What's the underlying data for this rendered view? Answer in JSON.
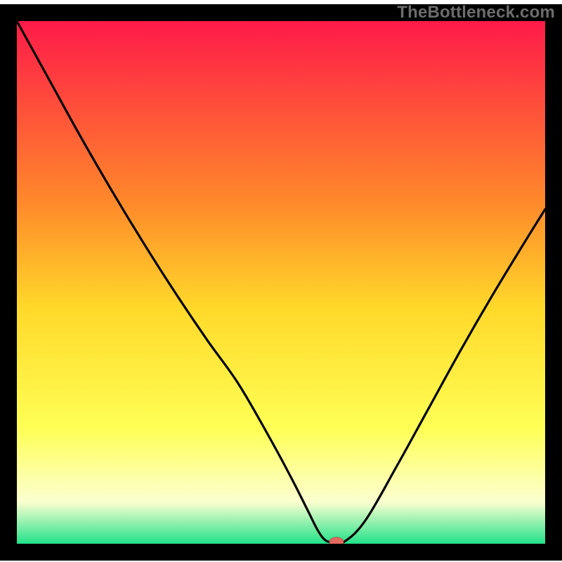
{
  "watermark": "TheBottleneck.com",
  "colors": {
    "border": "#000000",
    "curve": "#000000",
    "marker_fill": "#e46a5f",
    "marker_stroke": "#b95146",
    "grad_top": "#ff1a49",
    "grad_mid_upper": "#ff8a2a",
    "grad_mid": "#ffd92a",
    "grad_mid_lower": "#ffff55",
    "grad_low": "#fbffd0",
    "grad_bottom": "#23e28a"
  },
  "chart_data": {
    "type": "line",
    "title": "",
    "xlabel": "",
    "ylabel": "",
    "xlim": [
      0,
      100
    ],
    "ylim": [
      0,
      100
    ],
    "x": [
      0,
      6,
      12,
      18,
      24,
      30,
      36,
      42,
      48,
      52,
      55,
      57,
      58.5,
      60,
      62,
      66,
      72,
      78,
      84,
      90,
      96,
      100
    ],
    "values": [
      100,
      89,
      78,
      67.5,
      57.5,
      48,
      39,
      30.5,
      20,
      12.5,
      6.5,
      2.5,
      0.6,
      0.4,
      0.4,
      4.5,
      15,
      26,
      37,
      47.5,
      57.5,
      64
    ],
    "marker": {
      "x": 60.5,
      "y": 0.35
    },
    "flat_segment": {
      "x_start": 57.5,
      "x_end": 62.5,
      "y": 0.4
    }
  }
}
